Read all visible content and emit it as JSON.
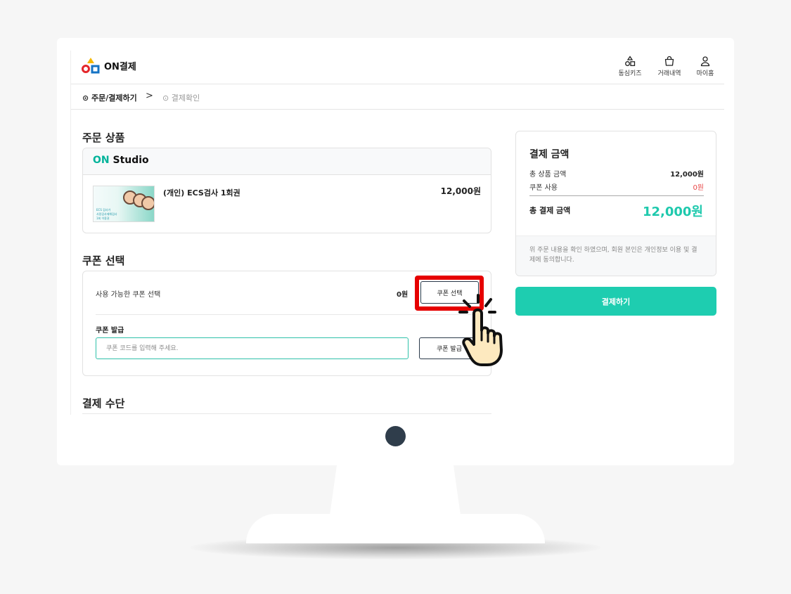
{
  "app": {
    "brand": "ON결제",
    "nav": [
      {
        "label": "동심키즈",
        "icon": "shapes-icon"
      },
      {
        "label": "거래내역",
        "icon": "shopping-bag-icon"
      },
      {
        "label": "마이홈",
        "icon": "user-icon"
      }
    ]
  },
  "breadcrumb": {
    "step1": "⊙ 주문/결제하기",
    "separator": ">",
    "step2": "⊙ 결제확인"
  },
  "order": {
    "title": "주문 상품",
    "store_prefix": "ON",
    "store_suffix": " Studio",
    "product_name": "(개인) ECS검사 1회권",
    "product_price": "12,000원",
    "thumb_lines": [
      "ECS 검사가",
      "사람검사재해검사",
      "1회 이용권"
    ]
  },
  "coupon": {
    "title": "쿠폰 선택",
    "available_label": "사용 가능한 쿠폰 선택",
    "amount": "0원",
    "select_button": "쿠폰 선택",
    "issue_label": "쿠폰 발급",
    "code_placeholder": "쿠폰 코드를 입력해 주세요.",
    "issue_button": "쿠폰 발급"
  },
  "payment_method": {
    "title": "결제 수단"
  },
  "summary": {
    "title": "결제 금액",
    "rows": [
      {
        "label": "총 상품 금액",
        "value": "12,000원"
      },
      {
        "label": "쿠폰 사용",
        "value": "0원"
      }
    ],
    "total_label": "총 결제 금액",
    "total_value": "12,000원",
    "notice": "위 주문 내용을 확인 하였으며, 회원 본인은 개인정보 이용 및 결제에 동의합니다.",
    "pay_button": "결제하기"
  },
  "colors": {
    "accent": "#1ecdb0",
    "highlight": "#e60000",
    "coupon_used": "#e84848"
  }
}
